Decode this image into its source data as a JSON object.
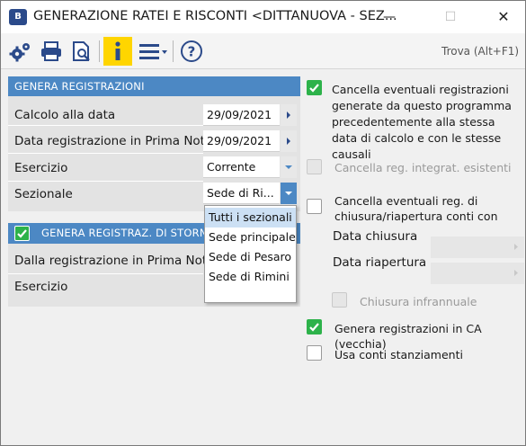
{
  "window": {
    "app_icon": "B",
    "title": "GENERAZIONE RATEI E RISCONTI <DITTANUOVA - SEZ...",
    "minimize": "—",
    "maximize": "☐",
    "close": "✕"
  },
  "toolbar": {
    "icons": [
      "gears-icon",
      "print-icon",
      "preview-icon",
      "info-icon",
      "menu-icon",
      "help-icon"
    ],
    "search_placeholder": "Trova (Alt+F1)"
  },
  "genera": {
    "header": "GENERA REGISTRAZIONI",
    "calcolo_label": "Calcolo alla data",
    "calcolo_value": "29/09/2021",
    "data_reg_label": "Data registrazione in Prima Nota",
    "data_reg_value": "29/09/2021",
    "esercizio_label": "Esercizio",
    "esercizio_value": "Corrente",
    "sezionale_label": "Sezionale",
    "sezionale_value": "Sede di Ri..."
  },
  "storno": {
    "header": "GENERA REGISTRAZ. DI STORNO",
    "checked": true,
    "dalla_reg_label": "Dalla registrazione in Prima Nota",
    "esercizio_label": "Esercizio"
  },
  "sezionale_options": [
    "Tutti i sezionali",
    "Sede principale",
    "Sede di Pesaro",
    "Sede di Rimini"
  ],
  "options": {
    "cancella_eventuali": "Cancella eventuali registrazioni generate da questo programma precedentemente alla stessa data di calcolo e con le stesse causali",
    "cancella_integrat": "Cancella reg. integrat. esistenti",
    "cancella_chiusura": "Cancella eventuali reg. di chiusura/riapertura conti con",
    "data_chiusura": "Data chiusura",
    "data_riapertura": "Data riapertura",
    "chiusura_infrannuale": "Chiusura infrannuale",
    "genera_ca": "Genera registrazioni in CA (vecchia)",
    "usa_conti": "Usa conti stanziamenti"
  },
  "colors": {
    "accent": "#4c88c4",
    "check": "#2db24a",
    "info_button": "#ffd500"
  }
}
